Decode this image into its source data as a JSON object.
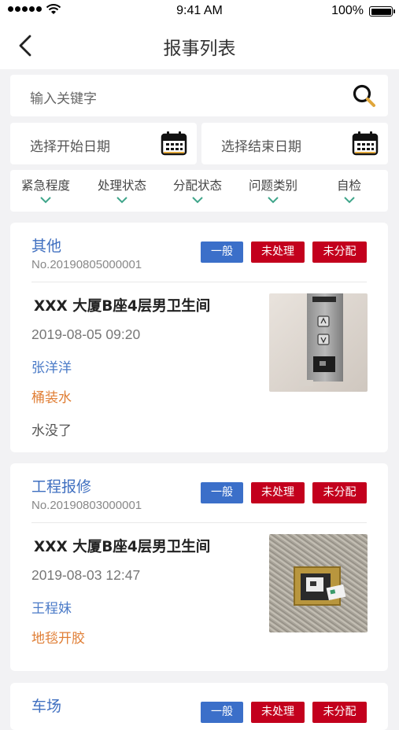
{
  "status_bar": {
    "time": "9:41 AM",
    "battery": "100%"
  },
  "nav": {
    "title": "报事列表"
  },
  "search": {
    "placeholder": "输入关键字"
  },
  "dates": {
    "start_placeholder": "选择开始日期",
    "end_placeholder": "选择结束日期"
  },
  "filters": [
    "紧急程度",
    "处理状态",
    "分配状态",
    "问题类别",
    "自检"
  ],
  "cards": [
    {
      "category": "其他",
      "number": "No.20190805000001",
      "badges": [
        "一般",
        "未处理",
        "未分配"
      ],
      "location": "XXX 大厦B座4层男卫生间",
      "datetime": "2019-08-05 09:20",
      "person": "张洋洋",
      "issue": "桶装水",
      "description": "水没了",
      "photo": "elevator-panel-photo"
    },
    {
      "category": "工程报修",
      "number": "No.20190803000001",
      "badges": [
        "一般",
        "未处理",
        "未分配"
      ],
      "location": "XXX 大厦B座4层男卫生间",
      "datetime": "2019-08-03 12:47",
      "person": "王程妹",
      "issue": "地毯开胶",
      "photo": "floor-outlet-photo"
    },
    {
      "category": "车场",
      "badges": [
        "一般",
        "未处理",
        "未分配"
      ]
    }
  ],
  "colors": {
    "accent_blue": "#3b6fc9",
    "status_red": "#c3001d",
    "issue_orange": "#e07e35",
    "background": "#f2f2f4"
  }
}
